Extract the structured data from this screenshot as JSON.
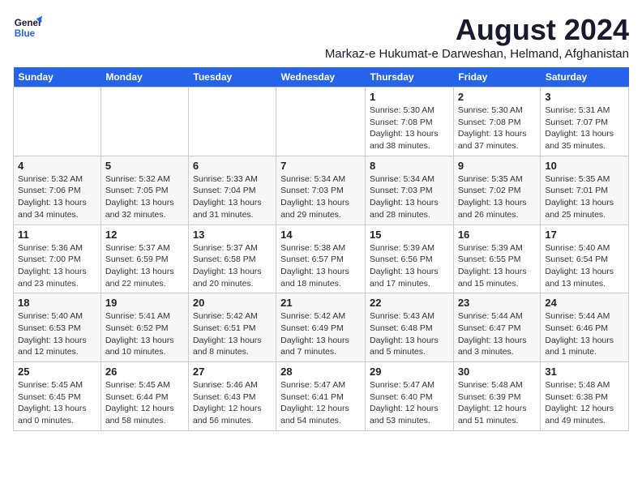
{
  "logo": {
    "line1": "General",
    "line2": "Blue"
  },
  "title": "August 2024",
  "subtitle": "Markaz-e Hukumat-e Darweshan, Helmand, Afghanistan",
  "weekdays": [
    "Sunday",
    "Monday",
    "Tuesday",
    "Wednesday",
    "Thursday",
    "Friday",
    "Saturday"
  ],
  "weeks": [
    [
      {
        "day": "",
        "info": ""
      },
      {
        "day": "",
        "info": ""
      },
      {
        "day": "",
        "info": ""
      },
      {
        "day": "",
        "info": ""
      },
      {
        "day": "1",
        "info": "Sunrise: 5:30 AM\nSunset: 7:08 PM\nDaylight: 13 hours\nand 38 minutes."
      },
      {
        "day": "2",
        "info": "Sunrise: 5:30 AM\nSunset: 7:08 PM\nDaylight: 13 hours\nand 37 minutes."
      },
      {
        "day": "3",
        "info": "Sunrise: 5:31 AM\nSunset: 7:07 PM\nDaylight: 13 hours\nand 35 minutes."
      }
    ],
    [
      {
        "day": "4",
        "info": "Sunrise: 5:32 AM\nSunset: 7:06 PM\nDaylight: 13 hours\nand 34 minutes."
      },
      {
        "day": "5",
        "info": "Sunrise: 5:32 AM\nSunset: 7:05 PM\nDaylight: 13 hours\nand 32 minutes."
      },
      {
        "day": "6",
        "info": "Sunrise: 5:33 AM\nSunset: 7:04 PM\nDaylight: 13 hours\nand 31 minutes."
      },
      {
        "day": "7",
        "info": "Sunrise: 5:34 AM\nSunset: 7:03 PM\nDaylight: 13 hours\nand 29 minutes."
      },
      {
        "day": "8",
        "info": "Sunrise: 5:34 AM\nSunset: 7:03 PM\nDaylight: 13 hours\nand 28 minutes."
      },
      {
        "day": "9",
        "info": "Sunrise: 5:35 AM\nSunset: 7:02 PM\nDaylight: 13 hours\nand 26 minutes."
      },
      {
        "day": "10",
        "info": "Sunrise: 5:35 AM\nSunset: 7:01 PM\nDaylight: 13 hours\nand 25 minutes."
      }
    ],
    [
      {
        "day": "11",
        "info": "Sunrise: 5:36 AM\nSunset: 7:00 PM\nDaylight: 13 hours\nand 23 minutes."
      },
      {
        "day": "12",
        "info": "Sunrise: 5:37 AM\nSunset: 6:59 PM\nDaylight: 13 hours\nand 22 minutes."
      },
      {
        "day": "13",
        "info": "Sunrise: 5:37 AM\nSunset: 6:58 PM\nDaylight: 13 hours\nand 20 minutes."
      },
      {
        "day": "14",
        "info": "Sunrise: 5:38 AM\nSunset: 6:57 PM\nDaylight: 13 hours\nand 18 minutes."
      },
      {
        "day": "15",
        "info": "Sunrise: 5:39 AM\nSunset: 6:56 PM\nDaylight: 13 hours\nand 17 minutes."
      },
      {
        "day": "16",
        "info": "Sunrise: 5:39 AM\nSunset: 6:55 PM\nDaylight: 13 hours\nand 15 minutes."
      },
      {
        "day": "17",
        "info": "Sunrise: 5:40 AM\nSunset: 6:54 PM\nDaylight: 13 hours\nand 13 minutes."
      }
    ],
    [
      {
        "day": "18",
        "info": "Sunrise: 5:40 AM\nSunset: 6:53 PM\nDaylight: 13 hours\nand 12 minutes."
      },
      {
        "day": "19",
        "info": "Sunrise: 5:41 AM\nSunset: 6:52 PM\nDaylight: 13 hours\nand 10 minutes."
      },
      {
        "day": "20",
        "info": "Sunrise: 5:42 AM\nSunset: 6:51 PM\nDaylight: 13 hours\nand 8 minutes."
      },
      {
        "day": "21",
        "info": "Sunrise: 5:42 AM\nSunset: 6:49 PM\nDaylight: 13 hours\nand 7 minutes."
      },
      {
        "day": "22",
        "info": "Sunrise: 5:43 AM\nSunset: 6:48 PM\nDaylight: 13 hours\nand 5 minutes."
      },
      {
        "day": "23",
        "info": "Sunrise: 5:44 AM\nSunset: 6:47 PM\nDaylight: 13 hours\nand 3 minutes."
      },
      {
        "day": "24",
        "info": "Sunrise: 5:44 AM\nSunset: 6:46 PM\nDaylight: 13 hours\nand 1 minute."
      }
    ],
    [
      {
        "day": "25",
        "info": "Sunrise: 5:45 AM\nSunset: 6:45 PM\nDaylight: 13 hours\nand 0 minutes."
      },
      {
        "day": "26",
        "info": "Sunrise: 5:45 AM\nSunset: 6:44 PM\nDaylight: 12 hours\nand 58 minutes."
      },
      {
        "day": "27",
        "info": "Sunrise: 5:46 AM\nSunset: 6:43 PM\nDaylight: 12 hours\nand 56 minutes."
      },
      {
        "day": "28",
        "info": "Sunrise: 5:47 AM\nSunset: 6:41 PM\nDaylight: 12 hours\nand 54 minutes."
      },
      {
        "day": "29",
        "info": "Sunrise: 5:47 AM\nSunset: 6:40 PM\nDaylight: 12 hours\nand 53 minutes."
      },
      {
        "day": "30",
        "info": "Sunrise: 5:48 AM\nSunset: 6:39 PM\nDaylight: 12 hours\nand 51 minutes."
      },
      {
        "day": "31",
        "info": "Sunrise: 5:48 AM\nSunset: 6:38 PM\nDaylight: 12 hours\nand 49 minutes."
      }
    ]
  ]
}
